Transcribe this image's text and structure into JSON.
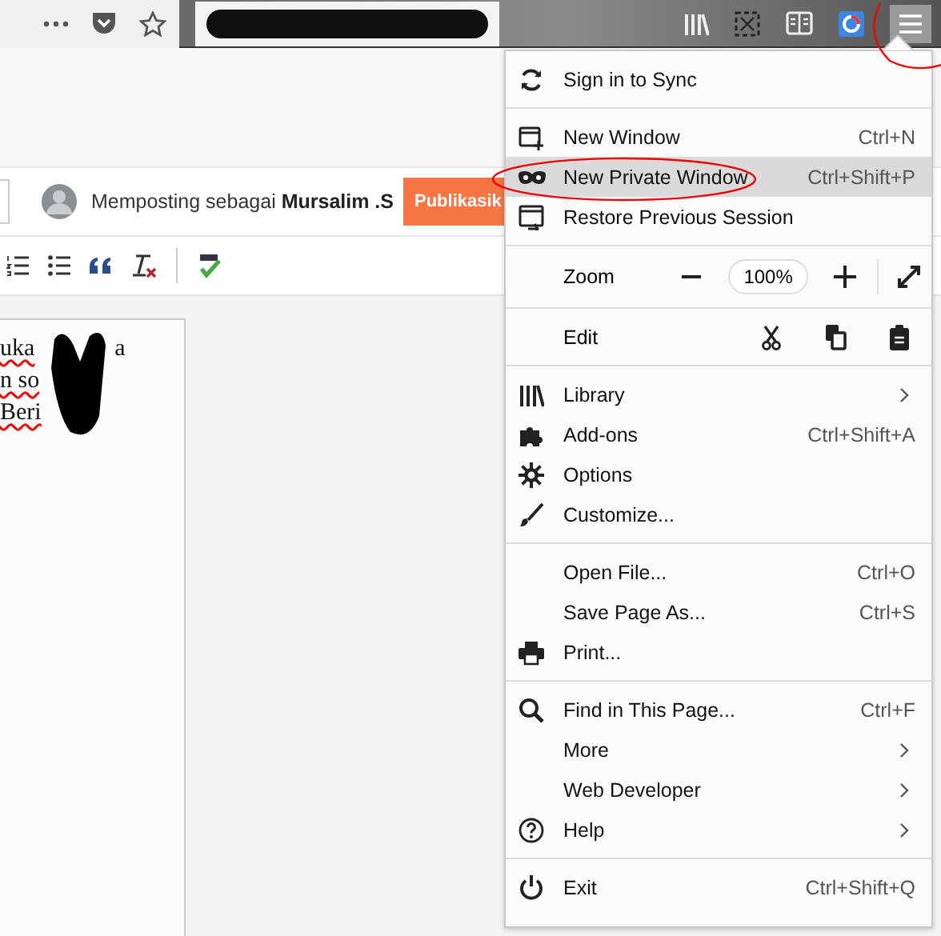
{
  "profile": {
    "text": "Memposting sebagai **Mursalim .S**",
    "publish": "Publikasik"
  },
  "editor": {
    "lines": [
      "uka",
      "n so",
      "Beri"
    ],
    "tail": "a"
  },
  "menu": {
    "sections": [
      {
        "items": [
          {
            "kind": "item",
            "label": "Sign in to Sync",
            "hovered": false
          }
        ]
      },
      {
        "items": [
          {
            "kind": "item",
            "label": "New Window",
            "shortcut": "Ctrl+N",
            "hovered": false
          },
          {
            "kind": "item",
            "label": "New Private Window",
            "shortcut": "Ctrl+Shift+P",
            "hovered": true
          },
          {
            "kind": "item",
            "label": "Restore Previous Session",
            "hovered": false
          }
        ]
      },
      {
        "items": [
          {
            "kind": "zoom",
            "label": "Zoom",
            "value": "100%"
          }
        ]
      },
      {
        "items": [
          {
            "kind": "edit",
            "label": "Edit"
          }
        ]
      },
      {
        "items": [
          {
            "kind": "item",
            "label": "Library",
            "submenu": true,
            "hovered": false
          },
          {
            "kind": "item",
            "label": "Add-ons",
            "shortcut": "Ctrl+Shift+A",
            "hovered": false
          },
          {
            "kind": "item",
            "label": "Options",
            "hovered": false
          },
          {
            "kind": "item",
            "label": "Customize...",
            "hovered": false
          }
        ]
      },
      {
        "items": [
          {
            "kind": "item",
            "label": "Open File...",
            "shortcut": "Ctrl+O",
            "hovered": false
          },
          {
            "kind": "item",
            "label": "Save Page As...",
            "shortcut": "Ctrl+S",
            "hovered": false
          },
          {
            "kind": "item",
            "label": "Print...",
            "hovered": false
          }
        ]
      },
      {
        "items": [
          {
            "kind": "item",
            "label": "Find in This Page...",
            "shortcut": "Ctrl+F",
            "hovered": false
          },
          {
            "kind": "item",
            "label": "More",
            "submenu": true,
            "hovered": false
          },
          {
            "kind": "item",
            "label": "Web Developer",
            "submenu": true,
            "hovered": false
          },
          {
            "kind": "item",
            "label": "Help",
            "submenu": true,
            "hovered": false
          }
        ]
      },
      {
        "items": [
          {
            "kind": "item",
            "label": "Exit",
            "shortcut": "Ctrl+Shift+Q",
            "hovered": false
          }
        ]
      }
    ]
  }
}
